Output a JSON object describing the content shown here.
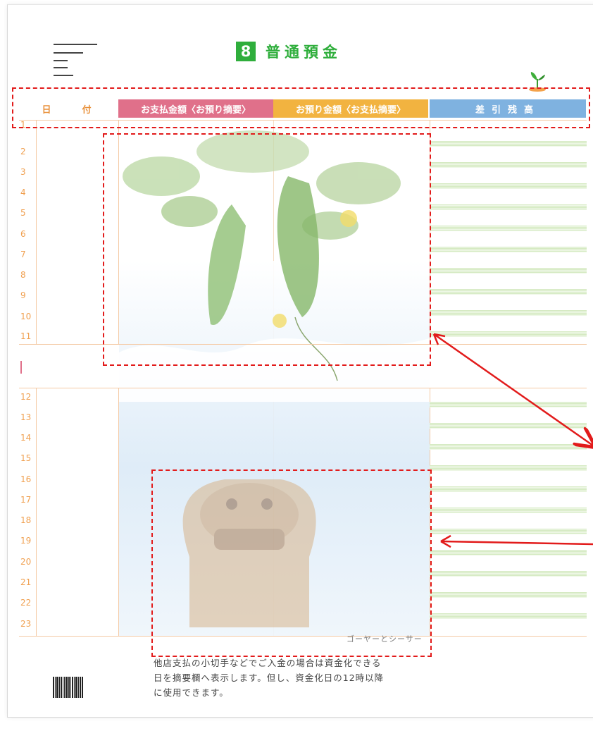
{
  "header": {
    "number_badge": "8",
    "title": "普通預金"
  },
  "columns": {
    "date_left": "日",
    "date_right": "付",
    "payment": "お支払金額〈お預り摘要〉",
    "deposit": "お預り金額〈お支払摘要〉",
    "balance": "差引残高"
  },
  "rows_top": [
    "1",
    "2",
    "3",
    "4",
    "5",
    "6",
    "7",
    "8",
    "9",
    "10",
    "11"
  ],
  "rows_bottom": [
    "12",
    "13",
    "14",
    "15",
    "16",
    "17",
    "18",
    "19",
    "20",
    "21",
    "22",
    "23"
  ],
  "artwork": {
    "top": "goya-vine",
    "bottom": "shisa-statue",
    "caption": "ゴーヤーとシーサー"
  },
  "footer": {
    "note_line1": "他店支払の小切手などでご入金の場合は資金化できる",
    "note_line2": "日を摘要欄へ表示します。但し、資金化日の12時以降",
    "note_line3": "に使用できます。"
  },
  "colors": {
    "accent_green": "#2fae3c",
    "annotation_red": "#e21b1b",
    "payment_pink": "#e0708a",
    "deposit_orange": "#f2b340",
    "balance_blue": "#7fb2e0"
  }
}
